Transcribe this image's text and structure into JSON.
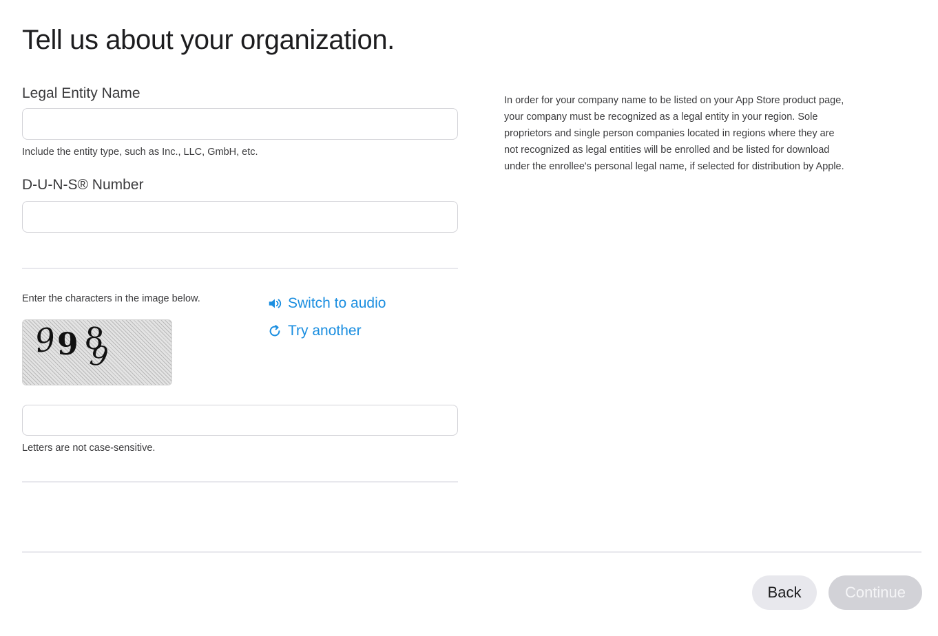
{
  "page": {
    "title": "Tell us about your organization."
  },
  "form": {
    "legal_entity": {
      "label": "Legal Entity Name",
      "value": "",
      "hint": "Include the entity type, such as Inc., LLC, GmbH, etc."
    },
    "duns": {
      "label": "D-U-N-S® Number",
      "value": ""
    },
    "captcha": {
      "instruction": "Enter the characters in the image below.",
      "switch_audio_label": "Switch to audio",
      "try_another_label": "Try another",
      "value": "",
      "hint": "Letters are not case-sensitive.",
      "image_chars": [
        "9",
        "9",
        "8",
        "9"
      ]
    }
  },
  "sidebar": {
    "info": "In order for your company name to be listed on your App Store product page, your company must be recognized as a legal entity in your region. Sole proprietors and single person companies located in regions where they are not recognized as legal entities will be enrolled and be listed for download under the enrollee's personal legal name, if selected for distribution by Apple."
  },
  "footer": {
    "back_label": "Back",
    "continue_label": "Continue",
    "continue_disabled": true
  },
  "colors": {
    "link": "#1a8ee0",
    "text": "#1d1d1f",
    "button_secondary": "#e8e8ed",
    "button_disabled": "#d2d2d7"
  }
}
